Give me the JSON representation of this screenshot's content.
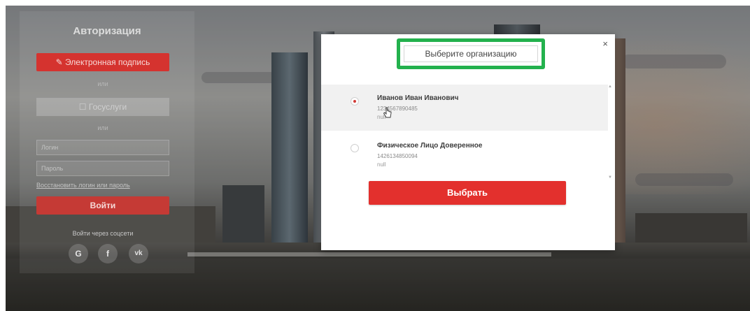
{
  "auth": {
    "title": "Авторизация",
    "esign_label": "✎ Электронная подпись",
    "or_1": "или",
    "gosuslugi_label": "☐ Госуслуги",
    "or_2": "или",
    "login_placeholder": "Логин",
    "password_placeholder": "Пароль",
    "forgot_link": "Восстановить логин или пароль",
    "login_button": "Войти",
    "social_caption": "Войти через соцсети",
    "social": [
      "G",
      "f",
      "vk"
    ]
  },
  "modal": {
    "title": "Выберите организацию",
    "close": "×",
    "organizations": [
      {
        "name": "Иванов Иван Иванович",
        "inn": "1234567890485",
        "extra": "null",
        "selected": true
      },
      {
        "name": "Физическое Лицо Доверенное",
        "inn": "1426134850094",
        "extra": "null",
        "selected": false
      }
    ],
    "select_button": "Выбрать"
  },
  "colors": {
    "accent_red": "#e3302d",
    "highlight_green": "#23b14d"
  }
}
